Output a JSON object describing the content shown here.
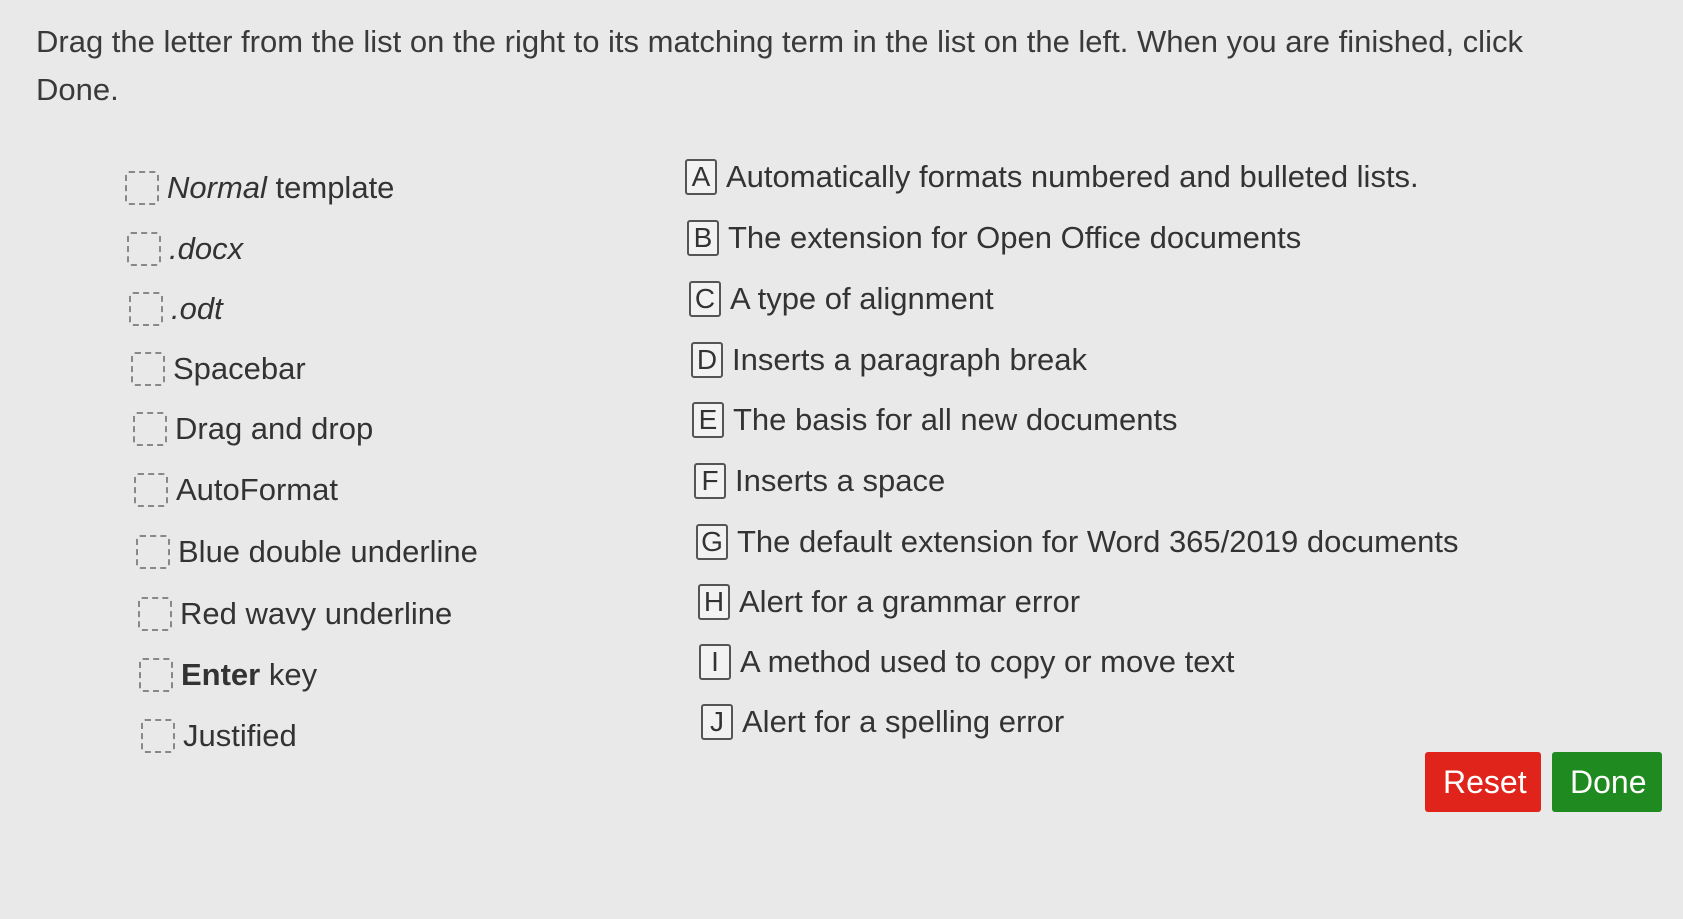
{
  "instructions": "Drag the letter from the list on the right to its matching term in the list on the left. When you are finished, click Done.",
  "terms": [
    {
      "pre_italic": "Normal",
      "rest": " template"
    },
    {
      "pre_italic": ".docx",
      "rest": ""
    },
    {
      "pre_italic": ".odt",
      "rest": ""
    },
    {
      "plain": "Spacebar"
    },
    {
      "plain": "Drag and drop"
    },
    {
      "plain": "AutoFormat"
    },
    {
      "plain": "Blue double underline"
    },
    {
      "plain": "Red wavy underline"
    },
    {
      "pre_bold": "Enter",
      "rest": " key"
    },
    {
      "plain": "Justified"
    }
  ],
  "definitions": [
    {
      "letter": "A",
      "text": "Automatically formats numbered and bulleted lists."
    },
    {
      "letter": "B",
      "text": "The extension for Open Office documents"
    },
    {
      "letter": "C",
      "text": "A type of alignment"
    },
    {
      "letter": "D",
      "text": "Inserts a paragraph break"
    },
    {
      "letter": "E",
      "text": "The basis for all new documents"
    },
    {
      "letter": "F",
      "text": "Inserts a space"
    },
    {
      "letter": "G",
      "text": "The default extension for Word 365/2019 documents"
    },
    {
      "letter": "H",
      "text": "Alert for a grammar error"
    },
    {
      "letter": "I",
      "text": "A method used to copy or move text"
    },
    {
      "letter": "J",
      "text": "Alert for a spelling error"
    }
  ],
  "buttons": {
    "reset": "Reset",
    "done": "Done"
  },
  "colors": {
    "reset": "#e0241b",
    "done": "#1f8a1f"
  }
}
